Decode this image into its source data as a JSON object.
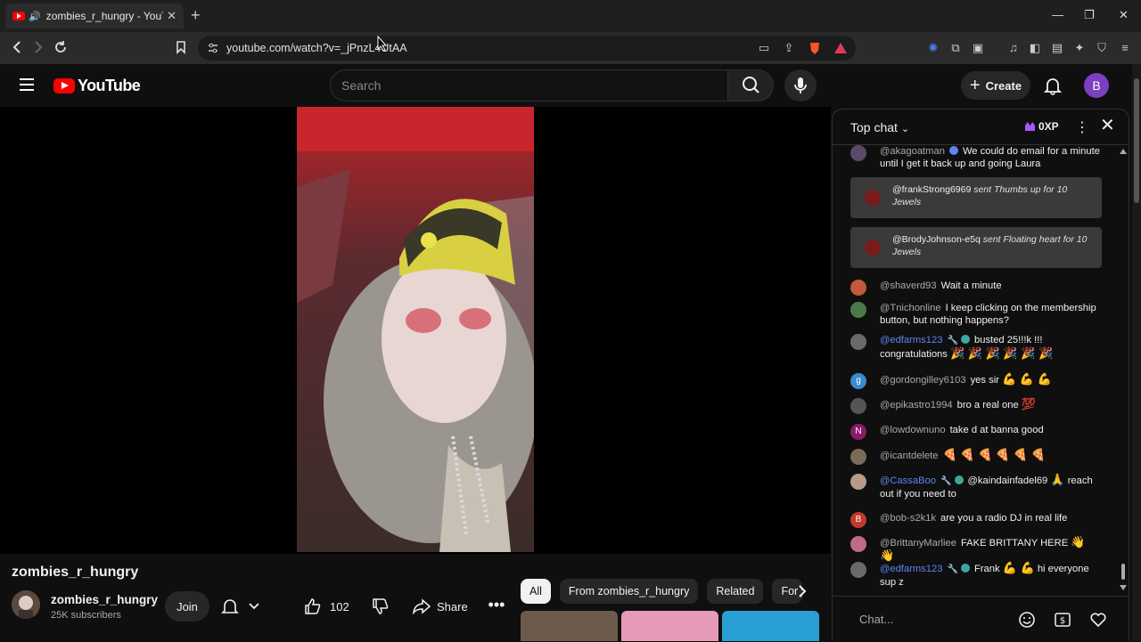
{
  "browser": {
    "tab_title": "zombies_r_hungry - YouTube",
    "audio_icon": "speaker-icon",
    "url": "youtube.com/watch?v=_jPnzL4UtAA"
  },
  "header": {
    "logo_text": "YouTube",
    "search_placeholder": "Search",
    "create_label": "Create",
    "avatar_letter": "B",
    "brand_color": "#ff0000"
  },
  "video": {
    "channel_heading": "zombies_r_hungry",
    "channel_name": "zombies_r_hungry",
    "subscribers": "25K subscribers",
    "join_label": "Join",
    "like_count": "102",
    "share_label": "Share"
  },
  "chips": [
    "All",
    "From zombies_r_hungry",
    "Related",
    "For y"
  ],
  "chat": {
    "title": "Top chat",
    "xp": "0XP",
    "input_placeholder": "Chat...",
    "messages": [
      {
        "user": "@akagoatman",
        "text": "We could do email for a minute until I get it back up and going Laura",
        "mod": false
      },
      {
        "type": "gift",
        "user": "@frankStrong6969",
        "text": "sent Thumbs up for 10 Jewels"
      },
      {
        "type": "gift",
        "user": "@BrodyJohnson-e5q",
        "text": "sent Floating heart for 10 Jewels"
      },
      {
        "user": "@shaverd93",
        "text": "Wait a minute"
      },
      {
        "user": "@Tnichonline",
        "text": "I keep clicking on the membership button, but nothing happens?"
      },
      {
        "user": "@edfarms123",
        "text": "busted 25!!!k !!! congratulations",
        "emoji": "🎉 🎉 🎉 🎉 🎉 🎉",
        "mod": true
      },
      {
        "user": "@gordongilley6103",
        "text": "yes sir",
        "emoji": "💪 💪 💪"
      },
      {
        "user": "@epikastro1994",
        "text": "bro a real one",
        "emoji": "💯"
      },
      {
        "user": "@lowdownuno",
        "text": "take d at banna good"
      },
      {
        "user": "@icantdelete",
        "text": "",
        "emoji": "🍕 🍕 🍕 🍕 🍕 🍕"
      },
      {
        "user": "@CassaBoo",
        "text": "@kaindainfadel69",
        "emoji": "🙏",
        "text2": "reach out if you need to",
        "mod": true
      },
      {
        "user": "@bob-s2k1k",
        "text": "are you a radio DJ in real life"
      },
      {
        "user": "@BrittanyMarliee",
        "text": "FAKE BRITTANY HERE",
        "emoji": "👋 👋"
      },
      {
        "user": "@edfarms123",
        "text": "Frank",
        "emoji": "💪 💪",
        "text2": "hi everyone sup z",
        "mod": true
      }
    ]
  }
}
